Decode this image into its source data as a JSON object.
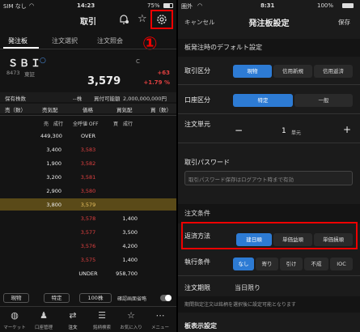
{
  "left_status": {
    "carrier": "SIM なし",
    "time": "14:23",
    "battery": "75%"
  },
  "left_header": {
    "title": "取引"
  },
  "left_tabs": [
    {
      "label": "発注板"
    },
    {
      "label": "注文選択"
    },
    {
      "label": "注文照会"
    }
  ],
  "annotation_number": "①",
  "stock": {
    "name": "ＳＢＩ",
    "code": "8473",
    "market": "東証",
    "partial": "C",
    "price": "3,579",
    "change": "+63",
    "change_pct": "+1.79 %"
  },
  "holdings": {
    "label": "保有株数",
    "shares": "--株",
    "buying_power_label": "買付可能額",
    "buying_power": "2,000,000,000円"
  },
  "board_header": {
    "sell_count": "売（数）",
    "sell_quote": "売気配",
    "price": "価格",
    "buy_quote": "買気配",
    "buy_count": "買（数）"
  },
  "board_subheader": {
    "left": "売　成行",
    "mid": "全呼値 OFF",
    "right": "買　成行"
  },
  "board_rows": [
    {
      "sell": "449,300",
      "price": "OVER",
      "buy": ""
    },
    {
      "sell": "3,400",
      "price": "3,583",
      "buy": ""
    },
    {
      "sell": "1,900",
      "price": "3,582",
      "buy": ""
    },
    {
      "sell": "3,200",
      "price": "3,581",
      "buy": ""
    },
    {
      "sell": "2,900",
      "price": "3,580",
      "buy": ""
    },
    {
      "sell": "3,800",
      "price": "3,579",
      "buy": ""
    },
    {
      "sell": "",
      "price": "3,578",
      "buy": "1,400"
    },
    {
      "sell": "",
      "price": "3,577",
      "buy": "3,500"
    },
    {
      "sell": "",
      "price": "3,576",
      "buy": "4,200"
    },
    {
      "sell": "",
      "price": "3,575",
      "buy": "1,400"
    },
    {
      "sell": "",
      "price": "UNDER",
      "buy": "958,700"
    }
  ],
  "bottom_controls": {
    "spot": "現物",
    "specific": "特定",
    "qty": "100株",
    "confirm": "確認画面省略"
  },
  "nav": [
    {
      "label": "マーケット",
      "icon": "globe-icon"
    },
    {
      "label": "口座管理",
      "icon": "person-icon"
    },
    {
      "label": "注文",
      "icon": "swap-icon"
    },
    {
      "label": "銘柄検索",
      "icon": "list-search-icon"
    },
    {
      "label": "お気に入り",
      "icon": "star-icon"
    },
    {
      "label": "メニュー",
      "icon": "more-icon"
    }
  ],
  "right_status": {
    "carrier": "圏外",
    "time": "8:31",
    "battery": "100%"
  },
  "right_header": {
    "cancel": "キャンセル",
    "title": "発注板設定",
    "save": "保存"
  },
  "section_default": "板発注時のデフォルト設定",
  "trade_type": {
    "label": "取引区分",
    "options": [
      "現物",
      "信用新規",
      "信用返済"
    ],
    "selected": 0
  },
  "account_type": {
    "label": "口座区分",
    "options": [
      "特定",
      "一般"
    ],
    "selected": 0
  },
  "order_unit": {
    "label": "注文単元",
    "value": "1",
    "unit": "単元",
    "minus": "−",
    "plus": "+"
  },
  "trade_password": {
    "label": "取引パスワード",
    "placeholder": "取引パスワード保存はログアウト時まで有効"
  },
  "section_conditions": "注文条件",
  "repay_method": {
    "label": "返済方法",
    "options": [
      "建日順",
      "単価益順",
      "単価損順"
    ],
    "selected": 0
  },
  "exec_cond": {
    "label": "執行条件",
    "options": [
      "なし",
      "寄り",
      "引け",
      "不成",
      "IOC"
    ],
    "selected": 0
  },
  "order_period": {
    "label": "注文期限",
    "value": "当日限り"
  },
  "period_note": "期間指定注文は銘柄を選択後に設定可能となります",
  "section_board_display": "板表示設定",
  "colors": {
    "accent": "#2d7bd4",
    "red": "#e04040",
    "highlight": "#e00000"
  }
}
